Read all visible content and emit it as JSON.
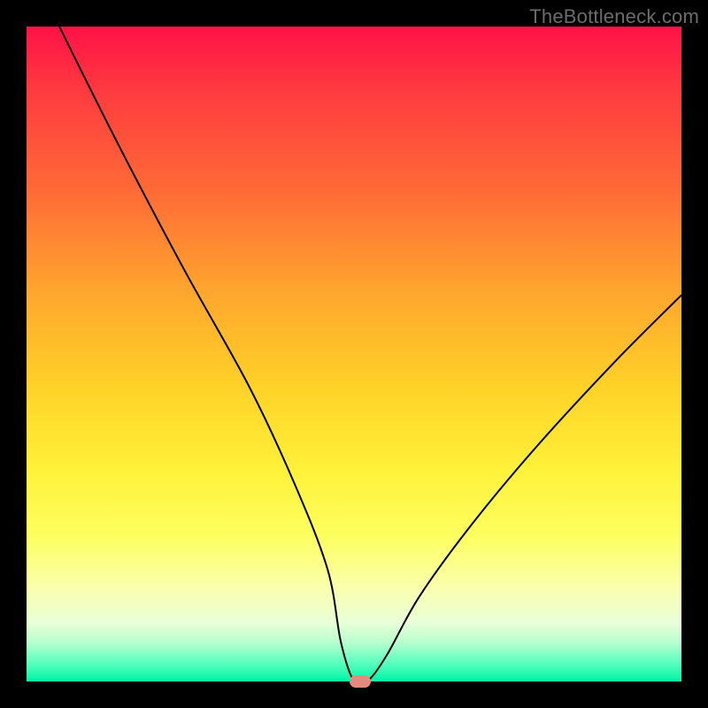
{
  "watermark": "TheBottleneck.com",
  "chart_data": {
    "type": "line",
    "title": "",
    "xlabel": "",
    "ylabel": "",
    "xlim": [
      0,
      100
    ],
    "ylim": [
      0,
      100
    ],
    "grid": false,
    "legend": false,
    "background_gradient": {
      "top": "#ff1247",
      "middle": "#ffe63a",
      "bottom": "#00f5a6"
    },
    "curve_original_units": {
      "x": [
        5,
        14,
        24,
        34,
        41,
        46,
        48,
        50,
        52,
        55,
        60,
        68,
        78,
        90,
        100
      ],
      "y": [
        100,
        82,
        63,
        45,
        30,
        17,
        6,
        0,
        0,
        4,
        13,
        24,
        36,
        49,
        59
      ]
    },
    "series": [
      {
        "name": "bottleneck-curve",
        "x": [
          5,
          14,
          24,
          34,
          41,
          46,
          48,
          50,
          52,
          55,
          60,
          68,
          78,
          90,
          100
        ],
        "y": [
          100,
          82,
          63,
          45,
          30,
          17,
          6,
          0,
          0,
          4,
          13,
          24,
          36,
          49,
          59
        ],
        "color": "#000000",
        "stroke_width": 2
      }
    ],
    "marker": {
      "x": 51,
      "y": 0,
      "color": "#e58a7f"
    }
  }
}
